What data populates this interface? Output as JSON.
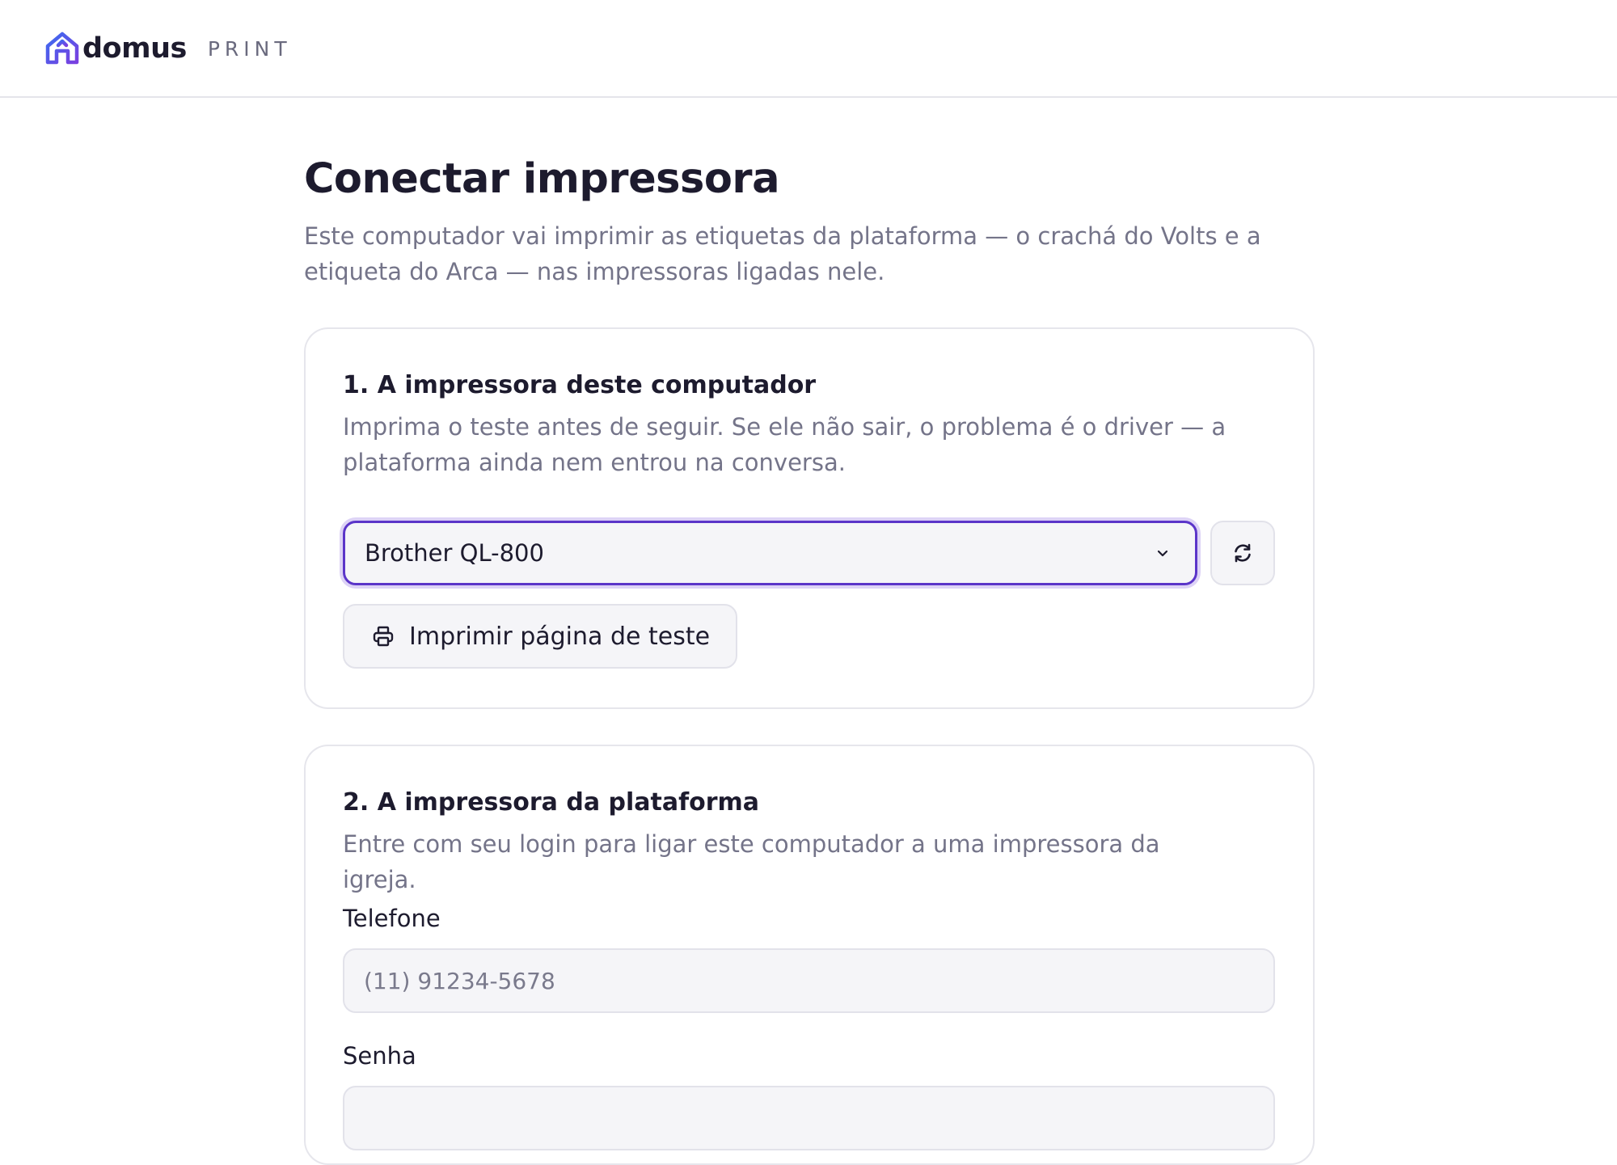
{
  "header": {
    "brand_name": "domus",
    "product_name": "PRINT"
  },
  "page": {
    "title": "Conectar impressora",
    "subtitle": "Este computador vai imprimir as etiquetas da plataforma — o crachá do Volts e a etiqueta do Arca — nas impressoras ligadas nele."
  },
  "step1": {
    "title": "1. A impressora deste computador",
    "description": "Imprima o teste antes de seguir. Se ele não sair, o problema é o driver — a plataforma ainda nem entrou na conversa.",
    "printer_select": {
      "selected": "Brother QL-800"
    },
    "refresh_icon": "refresh-icon",
    "test_button_label": "Imprimir página de teste",
    "test_button_icon": "printer-icon"
  },
  "step2": {
    "title": "2. A impressora da plataforma",
    "description": "Entre com seu login para ligar este computador a uma impressora da igreja.",
    "phone": {
      "label": "Telefone",
      "value": "",
      "placeholder": "(11) 91234-5678"
    },
    "password": {
      "label": "Senha",
      "value": "",
      "placeholder": ""
    }
  },
  "colors": {
    "brand_gradient_start": "#3b6cf0",
    "brand_gradient_end": "#7a3fe0",
    "focus_border": "#5b35c9",
    "focus_ring": "#ddd3f6",
    "text_primary": "#1d1b2e",
    "text_muted": "#747489"
  }
}
